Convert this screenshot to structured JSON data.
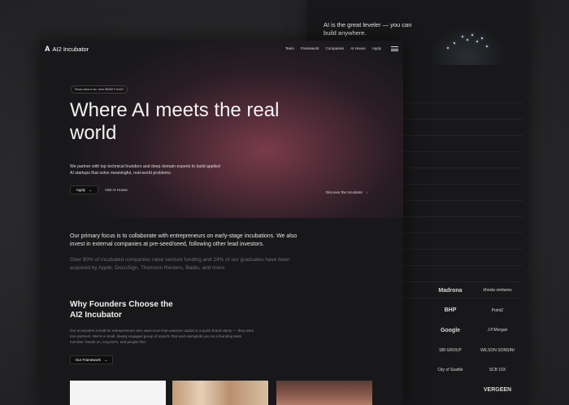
{
  "back_page": {
    "title": "AI is the great leveler — you can build anywhere.",
    "subtitle": "",
    "globe_caption": "",
    "lines": [
      "",
      "",
      "",
      "",
      "",
      "",
      "",
      "",
      "",
      "",
      "",
      "",
      ""
    ],
    "logos": [
      [
        "Madrona",
        "khosla ventures"
      ],
      [
        "BHP",
        "PointZ"
      ],
      [
        "Google",
        "J.P.Morgan"
      ],
      [
        "SBI GROUP",
        "WILSON SONSINI"
      ],
      [
        "City of Seattle",
        "SCB 10X"
      ],
      [
        "",
        "VERGEEN"
      ]
    ]
  },
  "nav": {
    "brand": "AI2 Incubator",
    "brand_mark": "A",
    "links": [
      "Team",
      "Framework",
      "Companies",
      "AI House",
      "Apply"
    ]
  },
  "hero": {
    "pill": "Read about our new $80M Fund3",
    "title": "Where AI meets the real world",
    "paragraph": "We partner with top technical founders and deep domain experts to build applied AI startups that solve meaningful, real-world problems.",
    "apply_label": "Apply",
    "visit_label": "Visit AI House",
    "discover_label": "Discover the Incubator"
  },
  "focus": {
    "primary": "Our primary focus is to collaborate with entrepreneurs on early-stage incubations. We also invest in external companies at pre-seed/seed, following other lead investors.",
    "stats": "Over 90% of incubated companies raise venture funding and 24% of our graduates have been acquired by Apple, DocuSign, Thomson Reuters, Baidu, and more."
  },
  "founders": {
    "title": "Why Founders Choose the AI2 Incubator",
    "paragraph": "Our ecosystem is built for entrepreneurs who want more than passive capital or a quick brand stamp — they want true partners. We're a small, deeply engaged group of experts that work alongside you as a founding team member: hands-on, long-term, and people-first.",
    "button_label": "Our Framework"
  }
}
